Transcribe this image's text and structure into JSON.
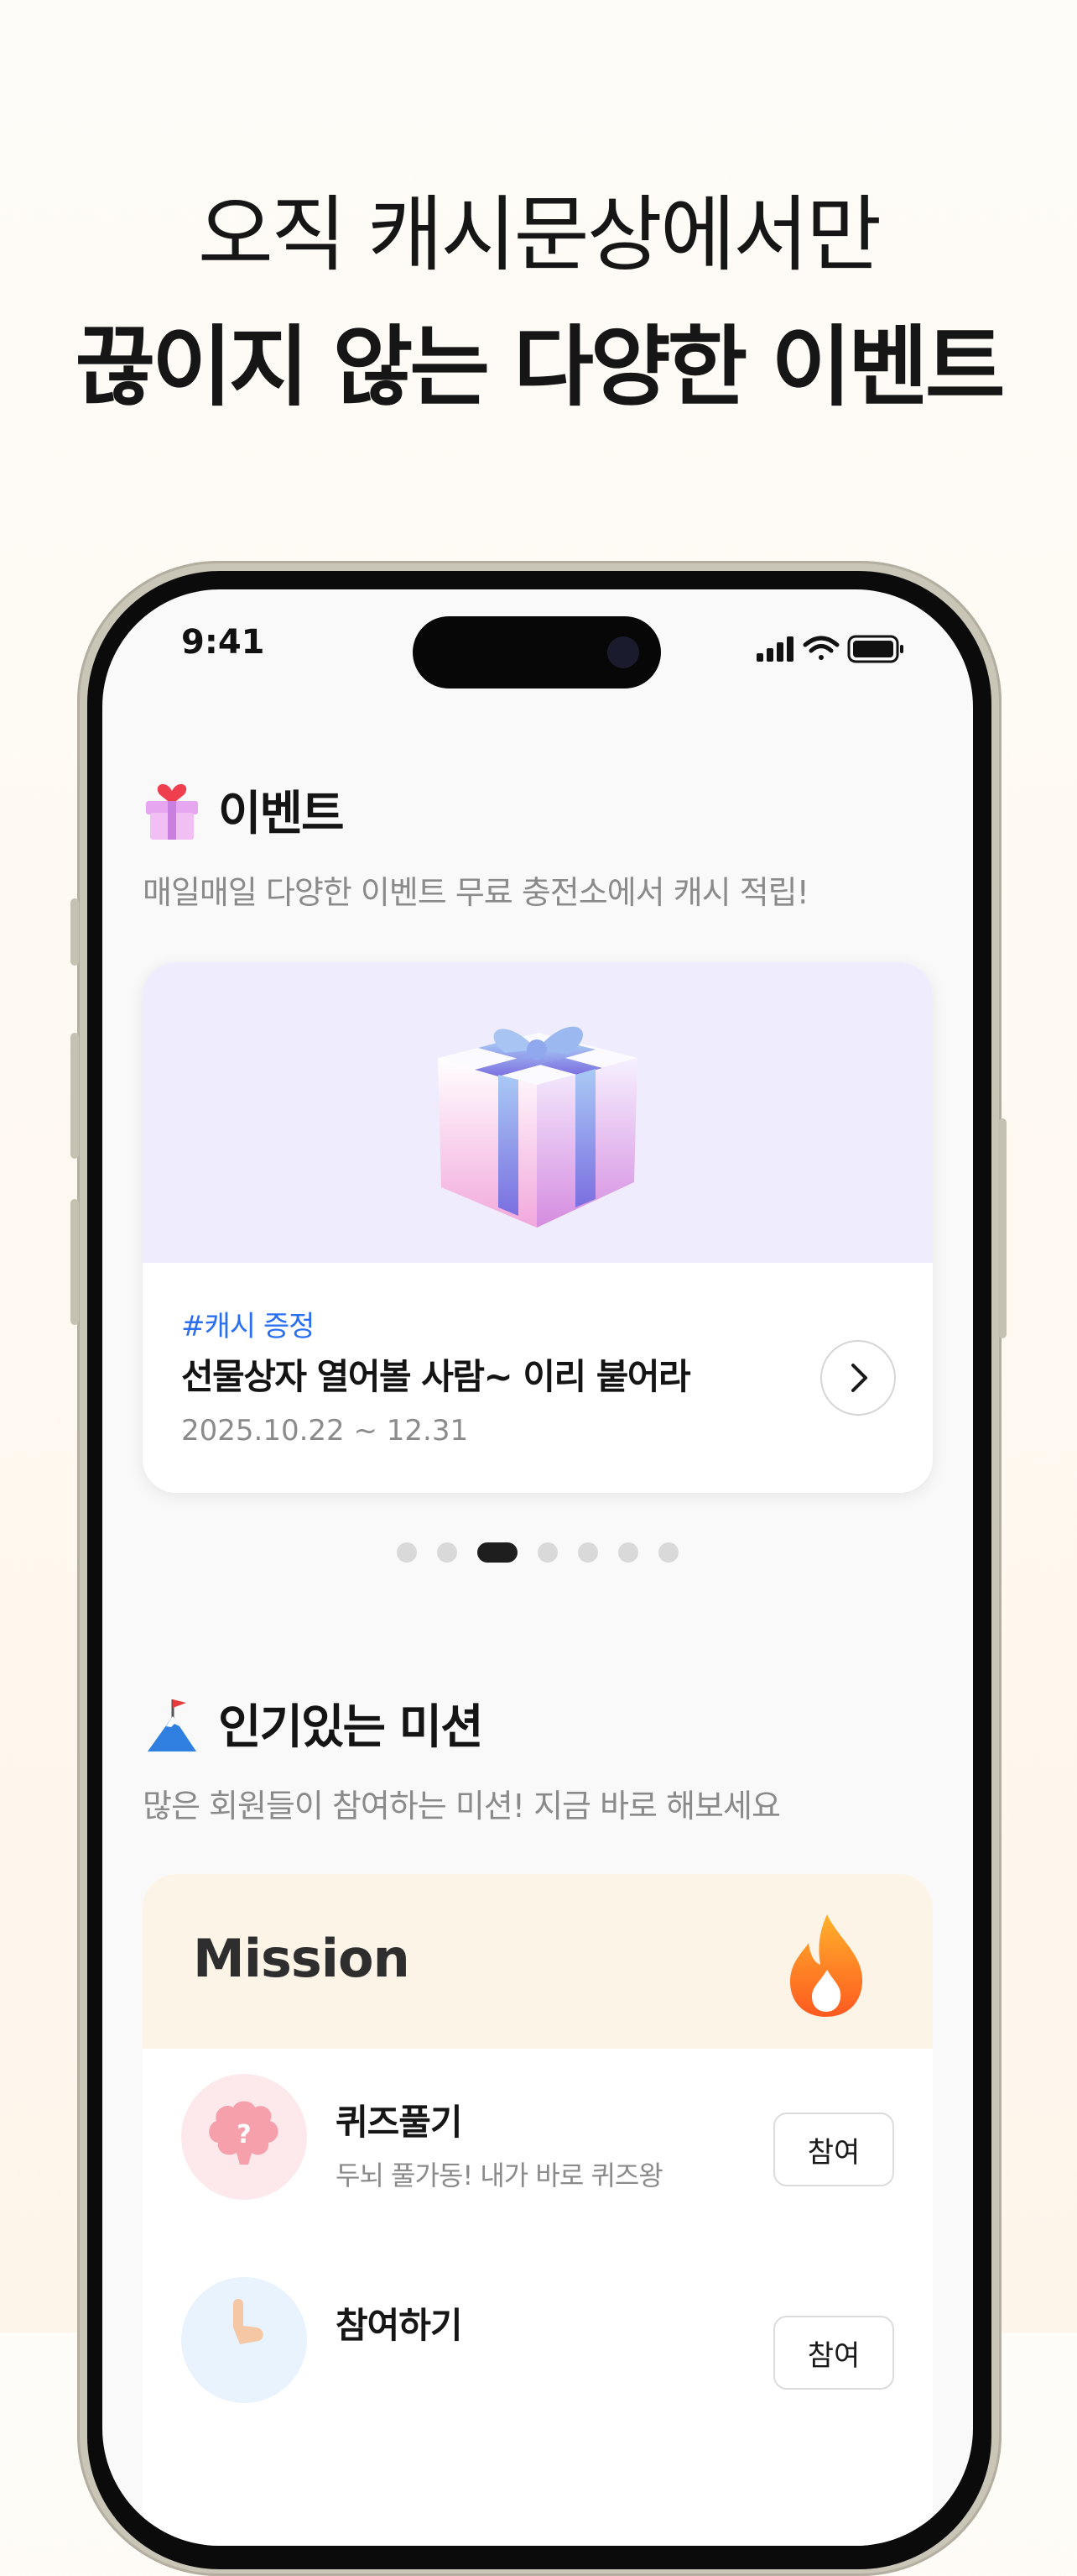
{
  "hero": {
    "line1": "오직 캐시문상에서만",
    "line2": "끊이지 않는 다양한 이벤트"
  },
  "status_bar": {
    "time": "9:41"
  },
  "events_section": {
    "title": "이벤트",
    "subtitle": "매일매일 다양한 이벤트 무료 충전소에서 캐시 적립!",
    "title_icon": "gift-icon",
    "card": {
      "tag": "#캐시 증정",
      "title": "선물상자 열어볼 사람~ 이리 붙어라",
      "date": "2025.10.22 ~ 12.31",
      "image_icon": "gift-box-icon"
    },
    "pagination": {
      "count": 7,
      "active_index": 2
    }
  },
  "missions_section": {
    "title": "인기있는 미션",
    "subtitle": "많은 회원들이 참여하는 미션! 지금 바로 해보세요",
    "title_icon": "mountain-flag-icon",
    "card_header": "Mission",
    "header_icon": "flame-icon",
    "items": [
      {
        "title": "퀴즈풀기",
        "description": "두뇌 풀가동! 내가 바로 퀴즈왕",
        "button": "참여",
        "icon": "brain-icon"
      },
      {
        "title": "참여하기",
        "description": "",
        "button": "참여",
        "icon": "hand-icon"
      }
    ]
  },
  "colors": {
    "accent_blue": "#2a6ff0",
    "event_bg": "#efedfd",
    "mission_header_bg": "#fdf4e8"
  }
}
